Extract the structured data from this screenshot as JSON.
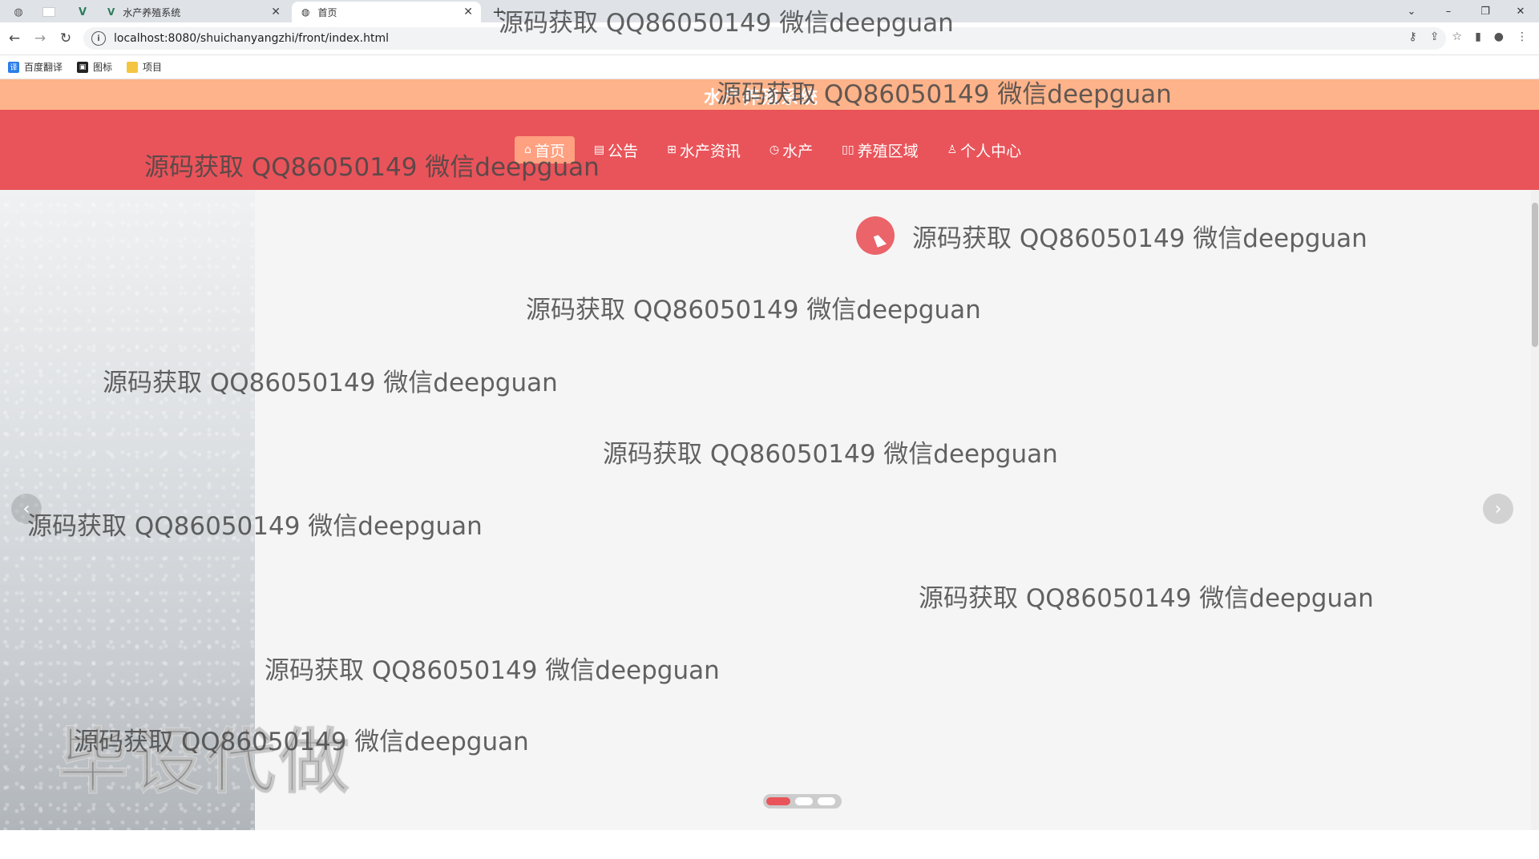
{
  "browser": {
    "tabs": [
      {
        "label": "水产养殖系统",
        "active": false
      },
      {
        "label": "首页",
        "active": true
      }
    ],
    "new_tab": "+",
    "url": "localhost:8080/shuichanyangzhi/front/index.html",
    "bookmarks": [
      {
        "label": "百度翻译",
        "icon": "translate-icon",
        "color": "#2b7de9"
      },
      {
        "label": "图标",
        "icon": "image-icon",
        "color": "#222222"
      },
      {
        "label": "项目",
        "icon": "folder-icon",
        "color": "#f4c542"
      }
    ]
  },
  "site": {
    "title": "水产养殖系统",
    "nav": [
      {
        "label": "首页",
        "icon": "home-icon",
        "glyph": "⌂",
        "active": true
      },
      {
        "label": "公告",
        "icon": "gift-icon",
        "glyph": "▤",
        "active": false
      },
      {
        "label": "水产资讯",
        "icon": "grid-icon",
        "glyph": "⊞",
        "active": false
      },
      {
        "label": "水产",
        "icon": "clock-icon",
        "glyph": "◷",
        "active": false
      },
      {
        "label": "养殖区域",
        "icon": "layout-icon",
        "glyph": "▯▯",
        "active": false
      },
      {
        "label": "个人中心",
        "icon": "user-icon",
        "glyph": "♙",
        "active": false
      }
    ]
  },
  "banner": {
    "prev_glyph": "‹",
    "next_glyph": "›",
    "slide_count": 3,
    "active_slide": 1
  },
  "watermarks": {
    "text": "源码获取 QQ86050149 微信deepguan",
    "stamp": "毕设代做"
  },
  "colors": {
    "accent": "#e9545a",
    "top_strip": "#ffb38a",
    "active_nav": "#ffa080"
  }
}
